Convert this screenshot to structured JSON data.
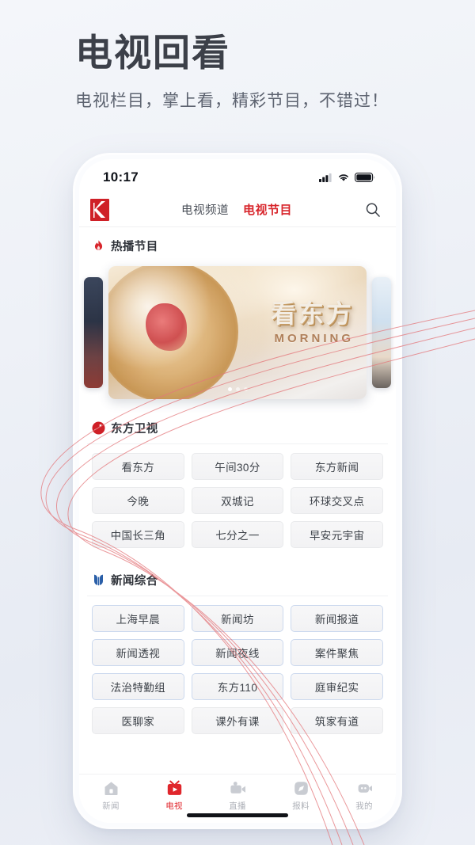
{
  "page": {
    "title": "电视回看",
    "subtitle": "电视栏目，掌上看，精彩节目，不错过！"
  },
  "colors": {
    "accent_red": "#d8262c",
    "tab_active_red": "#e0262c",
    "section_blue": "#2a5fa8",
    "background": "#eef1f7",
    "chip_bg": "#f4f4f6"
  },
  "phone": {
    "statusbar": {
      "time": "10:17",
      "signal_icon": "cellular-signal-icon",
      "wifi_icon": "wifi-icon",
      "battery_icon": "battery-full-icon"
    },
    "navbar": {
      "logo_icon": "kankan-news-logo",
      "search_icon": "search-icon",
      "tabs": [
        {
          "label": "电视频道",
          "active": false
        },
        {
          "label": "电视节目",
          "active": true
        }
      ]
    },
    "hot_section": {
      "icon": "flame-icon",
      "title": "热播节目",
      "carousel": {
        "active_index": 0,
        "total_dots": 3,
        "slide": {
          "title_cn": "看东方",
          "title_en": "MORNING"
        }
      }
    },
    "sections": [
      {
        "icon": "dragon-tv-icon",
        "title": "东方卫视",
        "programs": [
          "看东方",
          "午间30分",
          "东方新闻",
          "今晚",
          "双城记",
          "环球交叉点",
          "中国长三角",
          "七分之一",
          "早安元宇宙"
        ]
      },
      {
        "icon": "news-comprehensive-icon",
        "title": "新闻综合",
        "programs": [
          "上海早晨",
          "新闻坊",
          "新闻报道",
          "新闻透视",
          "新闻夜线",
          "案件聚焦",
          "法治特勤组",
          "东方110",
          "庭审纪实",
          "医聊家",
          "课外有课",
          "筑家有道"
        ]
      }
    ],
    "tabbar": [
      {
        "label": "新闻",
        "icon": "home-icon",
        "active": false
      },
      {
        "label": "电视",
        "icon": "tv-play-icon",
        "active": true
      },
      {
        "label": "直播",
        "icon": "video-camera-icon",
        "active": false
      },
      {
        "label": "报料",
        "icon": "compass-icon",
        "active": false
      },
      {
        "label": "我的",
        "icon": "person-icon",
        "active": false
      }
    ]
  }
}
